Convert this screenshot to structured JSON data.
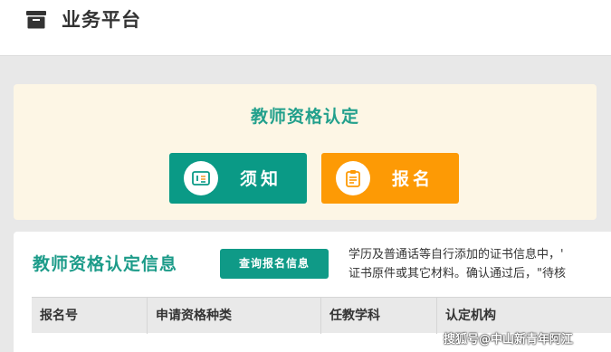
{
  "header": {
    "title": "业务平台",
    "icon": "archive-box-icon"
  },
  "qualification": {
    "heading": "教师资格认定",
    "notice_button": "须知",
    "apply_button": "报名"
  },
  "info": {
    "heading": "教师资格认定信息",
    "query_button": "查询报名信息",
    "notice_line1": "学历及普通话等自行添加的证书信息中，'",
    "notice_line2": "证书原件或其它材料。确认通过后，\"待核",
    "columns": [
      "报名号",
      "申请资格种类",
      "任教学科",
      "认定机构"
    ]
  },
  "watermark": "搜狐号@中山新青年阿江",
  "colors": {
    "teal": "#0a9a86",
    "orange": "#fd9a05",
    "banner_bg": "#fdf6e5"
  }
}
